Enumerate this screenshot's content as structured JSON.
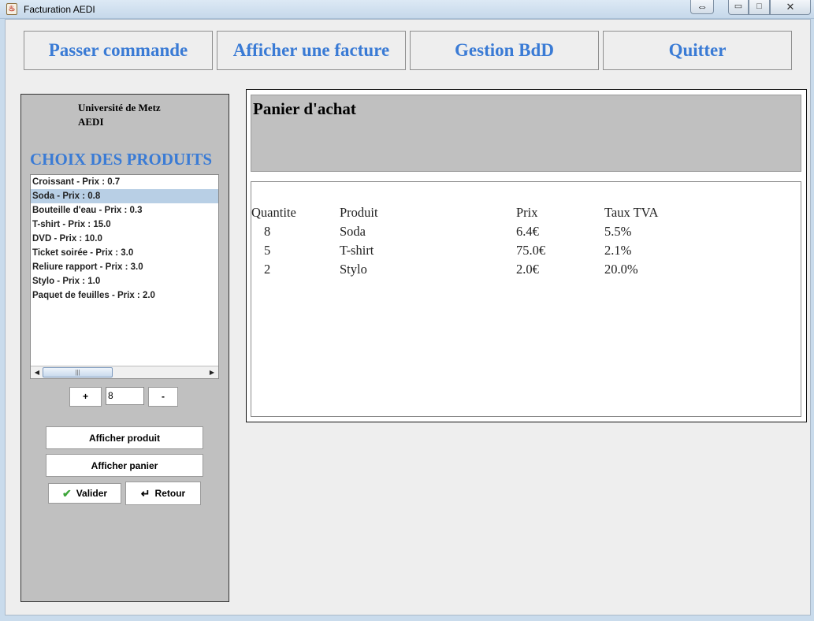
{
  "window": {
    "title": "Facturation AEDI",
    "resize_symbol": "⇔",
    "min_symbol": "▭",
    "max_symbol": "□",
    "close_symbol": "✕"
  },
  "top_nav": {
    "passer_commande": "Passer commande",
    "afficher_facture": "Afficher une facture",
    "gestion_bdd": "Gestion BdD",
    "quitter": "Quitter"
  },
  "left_panel": {
    "org_line1": "Université de Metz",
    "org_line2": "AEDI",
    "heading": "CHOIX DES PRODUITS",
    "products": [
      "Croissant - Prix : 0.7",
      "Soda - Prix : 0.8",
      "Bouteille d'eau - Prix : 0.3",
      "T-shirt - Prix : 15.0",
      "DVD - Prix : 10.0",
      "Ticket soirée - Prix : 3.0",
      "Reliure rapport - Prix : 3.0",
      "Stylo - Prix : 1.0",
      "Paquet de feuilles - Prix : 2.0"
    ],
    "selected_product": "Soda - Prix : 0.8",
    "plus_label": "+",
    "quantity_value": "8",
    "minus_label": "-",
    "afficher_produit": "Afficher produit",
    "afficher_panier": "Afficher panier",
    "valider": "Valider",
    "retour": "Retour"
  },
  "cart": {
    "title": "Panier d'achat",
    "headers": [
      "Quantite",
      "Produit",
      "Prix",
      "Taux TVA"
    ],
    "rows": [
      [
        "8",
        "Soda",
        "6.4€",
        "5.5%"
      ],
      [
        "5",
        "T-shirt",
        "75.0€",
        "2.1%"
      ],
      [
        "2",
        "Stylo",
        "2.0€",
        "20.0%"
      ]
    ]
  },
  "colors": {
    "accent": "#3a7bd5",
    "panel_grey": "#c0c0c0",
    "selection": "#b8cfe5",
    "check_green": "#3da53a"
  },
  "icons": {
    "app": "java-cup-icon",
    "valider": "checkmark-icon",
    "retour": "return-arrow-icon"
  }
}
